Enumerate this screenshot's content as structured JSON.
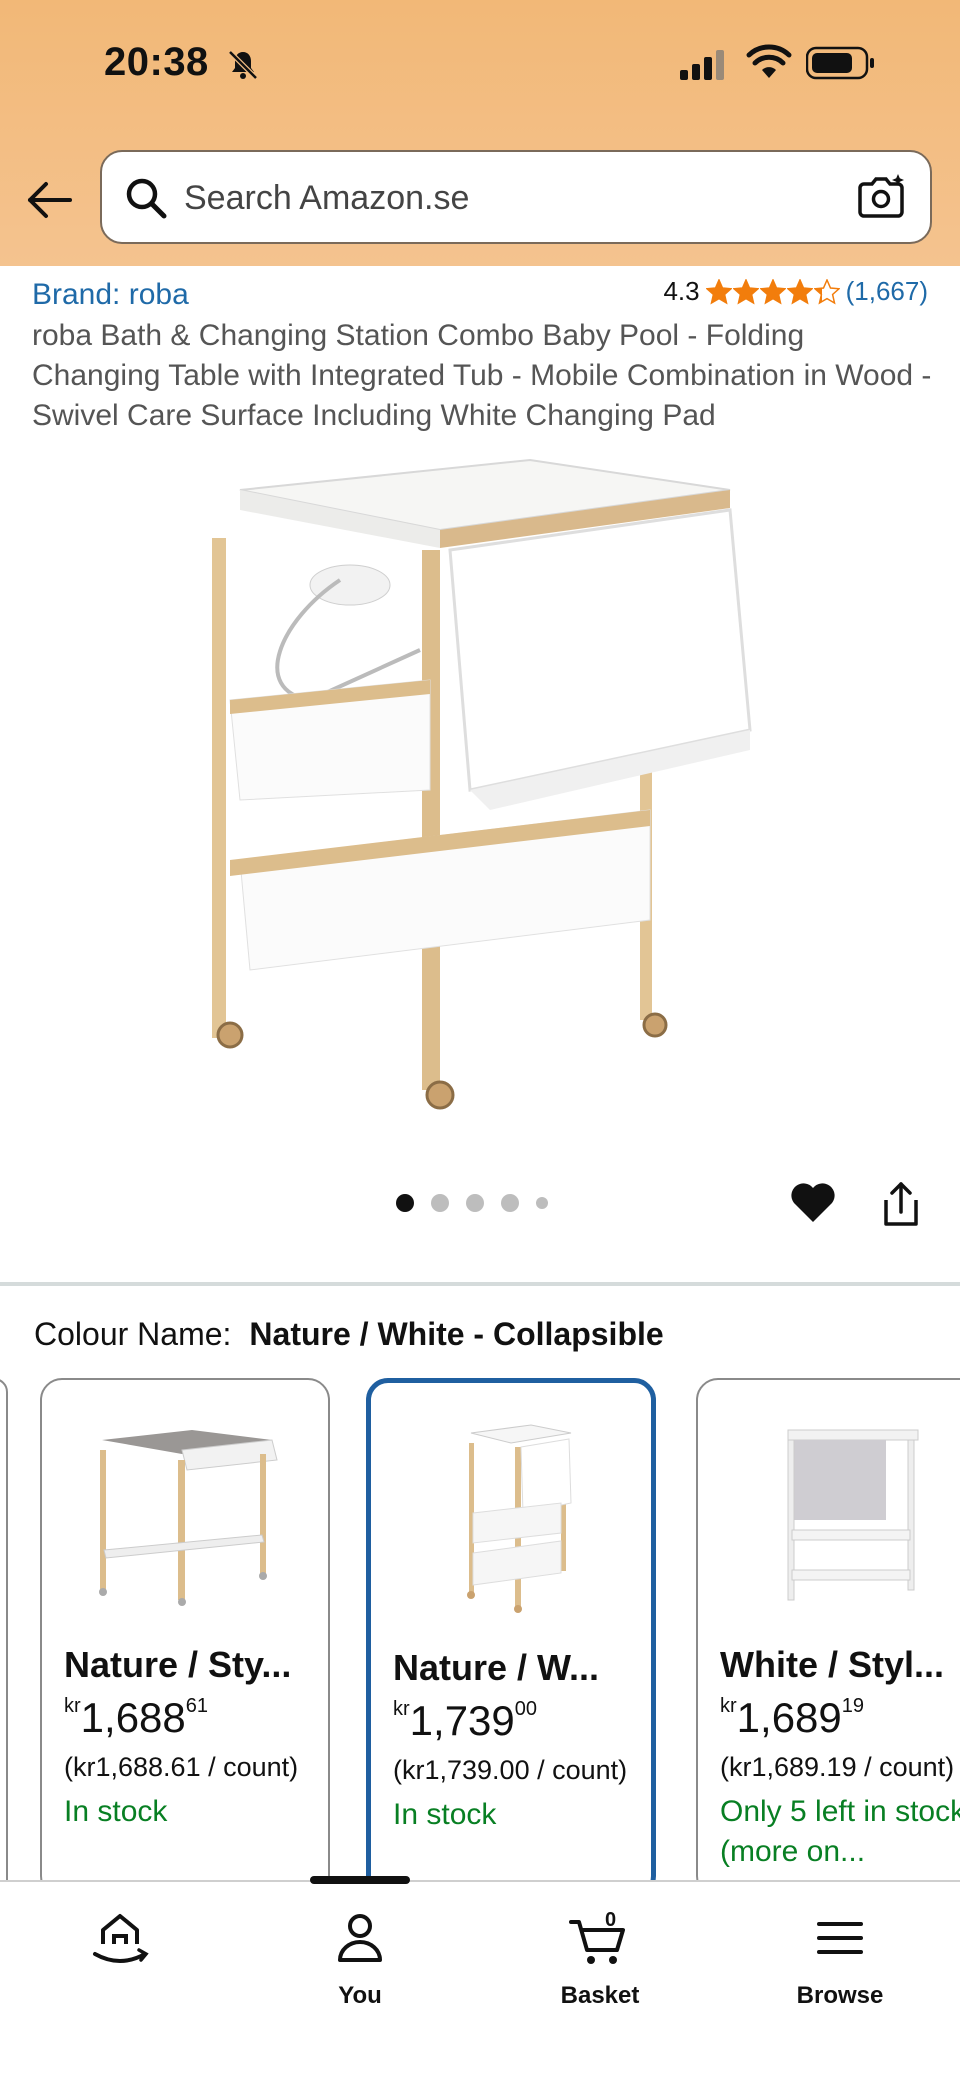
{
  "status_bar": {
    "time": "20:38",
    "icons": [
      "bell-slash-icon",
      "cellular-signal-icon",
      "wifi-icon",
      "battery-icon"
    ]
  },
  "search": {
    "placeholder": "Search Amazon.se",
    "icons": [
      "back-arrow-icon",
      "search-icon",
      "camera-lens-icon"
    ]
  },
  "product": {
    "brand": "Brand: roba",
    "rating_value": "4.3",
    "rating_stars": 4.3,
    "rating_count": "(1,667)",
    "title": "roba Bath & Changing Station Combo Baby Pool - Folding Changing Table with Integrated Tub - Mobile Combination in Wood - Swivel Care Surface Including White Changing Pad",
    "image_count": 5,
    "image_index": 1
  },
  "colour": {
    "label": "Colour Name:",
    "selected": "Nature / White - Collapsible",
    "options": [
      {
        "name": "Nature / Sty...",
        "currency": "kr",
        "price_whole": "1,688",
        "price_fraction": "61",
        "unit_price": "(kr1,688.61 / count)",
        "stock": "In stock",
        "selected": false
      },
      {
        "name": "Nature / W...",
        "currency": "kr",
        "price_whole": "1,739",
        "price_fraction": "00",
        "unit_price": "(kr1,739.00 / count)",
        "stock": "In stock",
        "selected": true
      },
      {
        "name": "White / Styl...",
        "currency": "kr",
        "price_whole": "1,689",
        "price_fraction": "19",
        "unit_price": "(kr1,689.19 / count)",
        "stock": "Only 5 left in stock (more on...",
        "selected": false
      }
    ]
  },
  "bottom_nav": {
    "items": [
      {
        "label": "",
        "icon": "home-icon"
      },
      {
        "label": "You",
        "icon": "person-icon"
      },
      {
        "label": "Basket",
        "icon": "basket-icon",
        "badge": "0"
      },
      {
        "label": "Browse",
        "icon": "menu-icon"
      }
    ]
  },
  "colors": {
    "header_bg": "#f2b877",
    "link": "#1f6aa8",
    "star": "#f27d0c",
    "in_stock": "#087f23",
    "selected_border": "#1f5fa0"
  }
}
